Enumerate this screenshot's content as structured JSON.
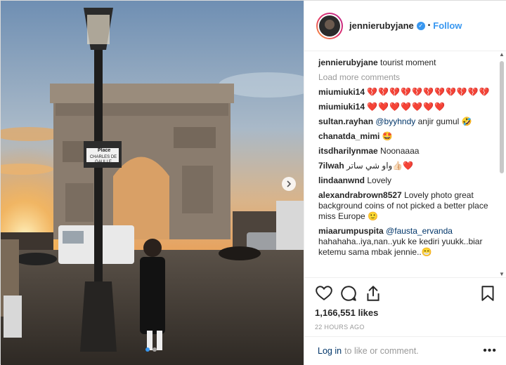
{
  "post": {
    "username": "jennierubyjane",
    "verified_icon": "verified-badge-icon",
    "separator": "•",
    "follow_label": "Follow",
    "caption_user": "jennierubyjane",
    "caption_text": "tourist moment",
    "load_more": "Load more comments",
    "comments": [
      {
        "user": "miumiuki14",
        "text": "💔💔💔💔💔💔💔💔💔💔💔"
      },
      {
        "user": "miumiuki14",
        "text": "❤️❤️❤️❤️❤️❤️❤️"
      },
      {
        "user": "sultan.rayhan",
        "mention": "@byyhndy",
        "text": " anjir gumul 🤣"
      },
      {
        "user": "chanatda_mimi",
        "text": "🤩"
      },
      {
        "user": "itsdharilynmae",
        "text": "Noonaaaa"
      },
      {
        "user": "7ilwah",
        "text": "واو شي ساتر👍🏻❤️"
      },
      {
        "user": "lindaanwnd",
        "text": "Lovely"
      },
      {
        "user": "alexandrabrown8527",
        "text": "Lovely photo great background coins of not picked a better place miss Europe 🙂"
      },
      {
        "user": "miaarumpuspita",
        "mention": "@fausta_ervanda",
        "text": "hahahaha..iya,nan..yuk ke kediri yuukk..biar ketemu sama mbak jennie..😁"
      }
    ],
    "likes": "1,166,551 likes",
    "time": "22 HOURS AGO",
    "login_link": "Log in",
    "login_rest": "to like or comment.",
    "more_options": "•••",
    "photo_sign_top": "Place",
    "photo_sign_bottom": "CHARLES DE GAULLE"
  },
  "colors": {
    "accent": "#3897f0",
    "link": "#003569",
    "muted": "#999999"
  }
}
